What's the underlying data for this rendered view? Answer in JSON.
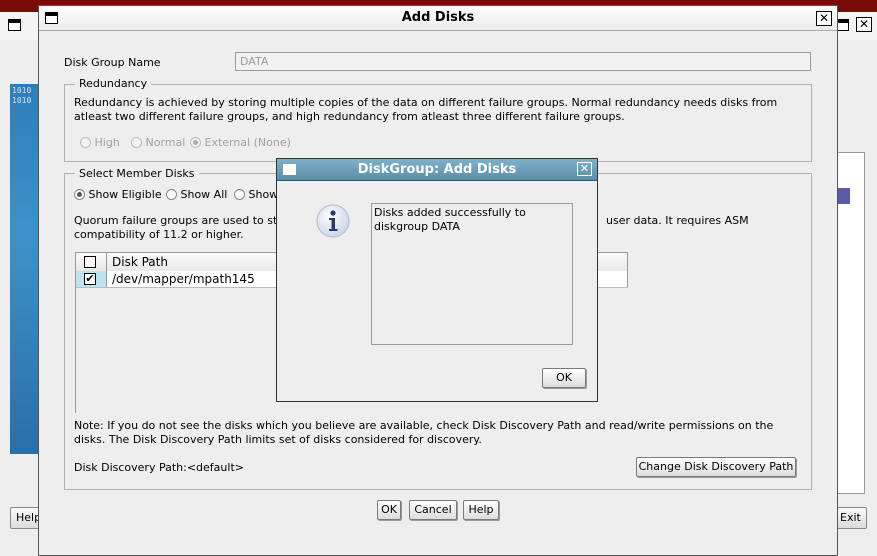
{
  "main_dialog": {
    "title": "Add Disks",
    "disk_group_name_label": "Disk Group Name",
    "disk_group_name_value": "DATA",
    "redundancy": {
      "legend": "Redundancy",
      "description": "Redundancy is achieved by storing multiple copies of the data on different failure groups. Normal redundancy needs disks from atleast two different failure groups, and high redundancy from atleast three different failure groups.",
      "options": [
        "High",
        "Normal",
        "External (None)"
      ],
      "selected": "External (None)"
    },
    "member_disks": {
      "legend": "Select Member Disks",
      "filter_options": [
        "Show Eligible",
        "Show All",
        "Show"
      ],
      "selected_filter": "Show Eligible",
      "quorum_note_start": "Quorum failure groups are used to sto",
      "quorum_note_end": "user data. It requires ASM",
      "quorum_note_line2": "compatibility of 11.2 or higher.",
      "table": {
        "columns": [
          "",
          "Disk Path"
        ],
        "rows": [
          {
            "checked": true,
            "disk_path": "/dev/mapper/mpath145"
          }
        ]
      },
      "discovery_note": "Note: If you do not see the disks which you believe are available, check Disk Discovery Path and read/write permissions on the disks. The Disk Discovery Path limits set of disks considered for discovery.",
      "discovery_path_label": "Disk Discovery Path:<default>",
      "change_discovery_button": "Change Disk Discovery Path"
    },
    "buttons": {
      "ok": "OK",
      "cancel": "Cancel",
      "help": "Help"
    }
  },
  "popup": {
    "title": "DiskGroup: Add Disks",
    "message": "Disks added successfully to\ndiskgroup DATA",
    "ok": "OK",
    "icon": "info-icon"
  },
  "background": {
    "bits_text": "1010\n1010",
    "help_button": "Help",
    "exit_button": "Exit"
  },
  "icons": {
    "window_box": "window-menu-icon",
    "close": "close-icon",
    "info": "info-icon",
    "checkbox_checked": "checkmark-icon"
  }
}
